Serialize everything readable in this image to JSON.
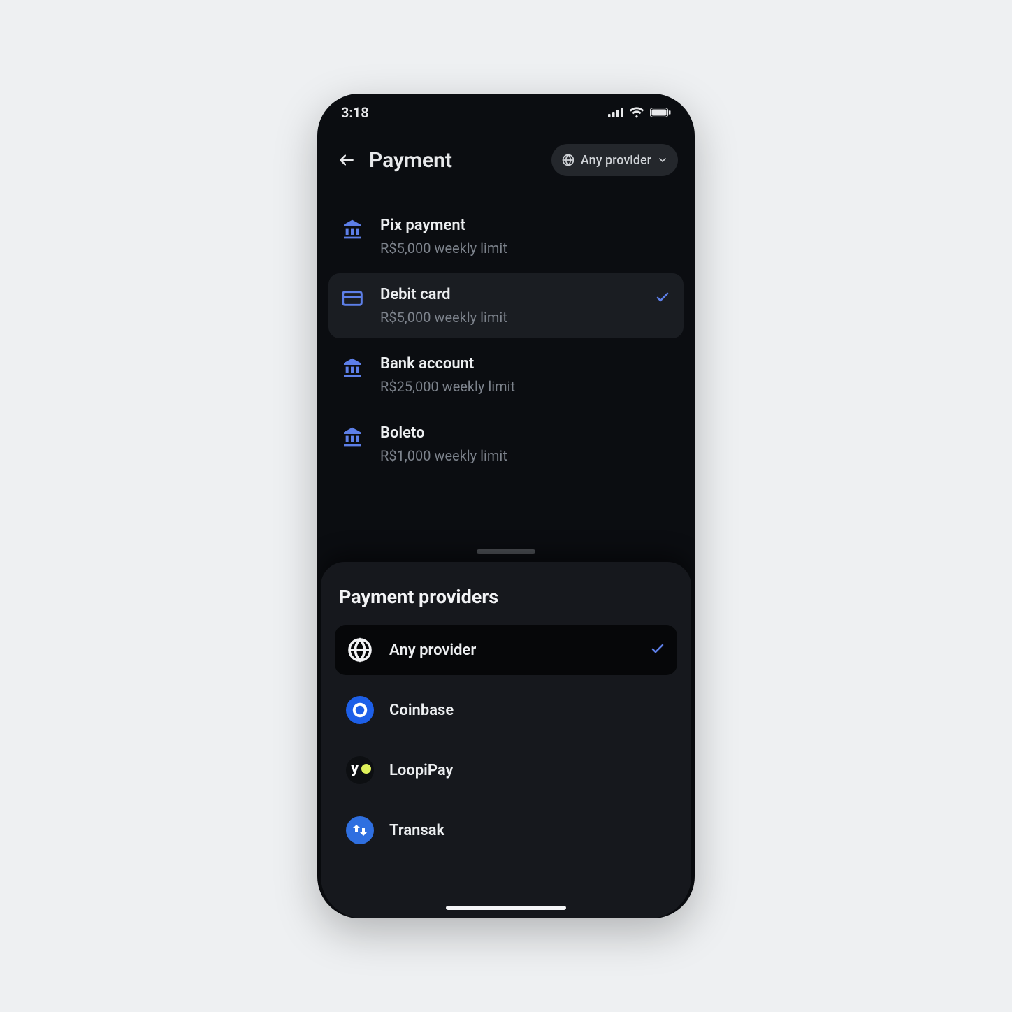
{
  "status": {
    "time": "3:18"
  },
  "header": {
    "title": "Payment",
    "provider_label": "Any provider"
  },
  "methods": [
    {
      "title": "Pix payment",
      "sub": "R$5,000 weekly limit",
      "icon": "bank",
      "selected": false
    },
    {
      "title": "Debit card",
      "sub": "R$5,000 weekly limit",
      "icon": "card",
      "selected": true
    },
    {
      "title": "Bank account",
      "sub": "R$25,000 weekly limit",
      "icon": "bank",
      "selected": false
    },
    {
      "title": "Boleto",
      "sub": "R$1,000 weekly limit",
      "icon": "bank",
      "selected": false
    }
  ],
  "sheet": {
    "title": "Payment providers",
    "providers": [
      {
        "name": "Any provider",
        "icon": "globe",
        "selected": true
      },
      {
        "name": "Coinbase",
        "icon": "coinbase",
        "selected": false
      },
      {
        "name": "LoopiPay",
        "icon": "loopipay",
        "selected": false
      },
      {
        "name": "Transak",
        "icon": "transak",
        "selected": false
      }
    ]
  },
  "colors": {
    "accent": "#5d7fe8",
    "bg": "#0b0d11",
    "sheet": "#16181d"
  }
}
